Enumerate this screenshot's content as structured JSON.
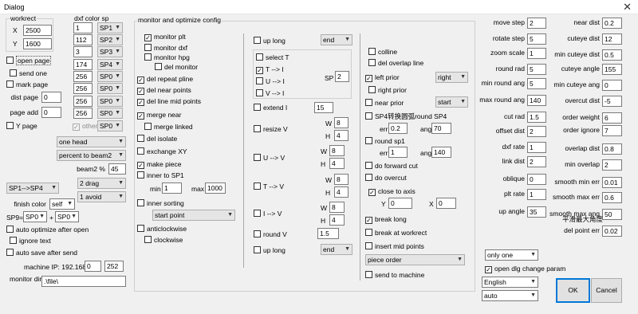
{
  "window": {
    "title": "Dialog",
    "close": "✕"
  },
  "workrect": {
    "label": "workrect",
    "x_label": "X",
    "x": "2500",
    "y_label": "Y",
    "y": "1600"
  },
  "left": {
    "open_page": "open page",
    "send_one": "send one",
    "mark_page": "mark page",
    "dist_page_label": "dist page",
    "dist_page": "0",
    "page_add_label": "page add",
    "page_add": "0",
    "y_page": "Y page"
  },
  "dxf_sp": {
    "label": "dxf color sp",
    "rows": [
      {
        "v": "1",
        "sp": "SP1"
      },
      {
        "v": "112",
        "sp": "SP2"
      },
      {
        "v": "3",
        "sp": "SP3"
      },
      {
        "v": "174",
        "sp": "SP4"
      },
      {
        "v": "256",
        "sp": "SP0"
      },
      {
        "v": "256",
        "sp": "SP0"
      },
      {
        "v": "256",
        "sp": "SP0"
      },
      {
        "v": "256",
        "sp": "SP0"
      }
    ],
    "other": "other",
    "other_sp": "SP0"
  },
  "head": {
    "one_head": "one head",
    "percent": "percent to beam2",
    "beam2_label": "beam2 %",
    "beam2": "45",
    "drag": "2 drag",
    "avoid": "1 avoid",
    "sp_route": "SP1-->SP4",
    "finish_color_label": "finish color",
    "finish_color": "self",
    "sp9_label": "SP9=",
    "sp9_a": "SP0",
    "plus": "+",
    "sp9_b": "SP0"
  },
  "bottom_left": {
    "auto_optimize": "auto optimize after open",
    "ignore_text": "ignore text",
    "auto_save": "auto save after send",
    "machine_ip_label": "machine IP: 192.168.",
    "ip3": "0",
    "ip4": "252",
    "monitor_dir_label": "monitor dir",
    "monitor_dir": ".\\file\\"
  },
  "monitor": {
    "title": "monitor and optimize config",
    "monitor_plt": "monitor plt",
    "monitor_dxf": "monitor dxf",
    "monitor_hpg": "monitor hpg",
    "del_monitor": "del monitor",
    "del_repeat": "del repeat pline",
    "del_near_points": "del near points",
    "del_line_mid": "del line mid points",
    "merge_near": "merge near",
    "merge_linked": "merge linked",
    "del_isolate": "del isolate",
    "exchange_xy": "exchange XY",
    "make_piece": "make piece",
    "inner_to_sp1": "inner to SP1",
    "min_label": "min",
    "min": "1",
    "max_label": "max",
    "max": "1000",
    "inner_sorting": "inner sorting",
    "start_point": "start point",
    "anticlockwise": "anticlockwise",
    "clockwise": "clockwise"
  },
  "col2": {
    "up_long": "up long",
    "up_long_sel": "end",
    "select_t": "select T",
    "t_i": "T --> I",
    "u_i": "U --> I",
    "v_i": "V --> I",
    "sp_label": "SP",
    "sp": "2",
    "extend_i": "extend I",
    "extend_i_val": "15",
    "resize_v": "resize V",
    "w": "W",
    "h": "H",
    "rv_w": "8",
    "rv_h": "4",
    "u_v": "U --> V",
    "uv_w": "8",
    "uv_h": "4",
    "t_v": "T --> V",
    "tv_w": "8",
    "tv_h": "4",
    "i_v": "I --> V",
    "iv_w": "8",
    "iv_h": "4",
    "round_v": "round V",
    "round_v_val": "1.5",
    "up_long2": "up long",
    "up_long2_sel": "end"
  },
  "col3": {
    "colline": "colline",
    "del_overlap": "del overlap line",
    "left_prior": "left prior",
    "left_prior_sel": "right",
    "right_prior": "right prior",
    "near_prior": "near prior",
    "near_prior_sel": "start",
    "sp4_round": "SP4转换圆弧round SP4",
    "err_label": "err",
    "err": "0.2",
    "ang_label": "ang",
    "ang": "70",
    "round_sp1": "round sp1",
    "err2": "1",
    "ang2": "140",
    "do_forward_cut": "do forward cut",
    "do_overcut": "do overcut",
    "close_to_axis": "close to axis",
    "y_label": "Y",
    "y": "0",
    "x_label": "X",
    "x": "0",
    "break_long": "break long",
    "break_at_workrect": "break at workrect",
    "insert_mid_points": "insert mid points",
    "piece_order": "piece order",
    "send_to_machine": "send to machine"
  },
  "right1": [
    {
      "l": "move step",
      "v": "2"
    },
    {
      "l": "rotate step",
      "v": "5"
    },
    {
      "l": "zoom scale",
      "v": "1"
    },
    {
      "l": "round rad",
      "v": "5"
    },
    {
      "l": "min round ang",
      "v": "5"
    },
    {
      "l": "max round ang",
      "v": "140"
    },
    {
      "l": "cut rad",
      "v": "1.5"
    },
    {
      "l": "offset dist",
      "v": "2"
    },
    {
      "l": "dxf rate",
      "v": "1"
    },
    {
      "l": "link dist",
      "v": "2"
    },
    {
      "l": "oblique",
      "v": "0"
    },
    {
      "l": "plt rate",
      "v": "1"
    },
    {
      "l": "up angle",
      "v": "35"
    }
  ],
  "right2": [
    {
      "l": "near dist",
      "v": "0.2"
    },
    {
      "l": "cuteye dist",
      "v": "12"
    },
    {
      "l": "min cuteye dist",
      "v": "0.5"
    },
    {
      "l": "cuteye angle",
      "v": "155"
    },
    {
      "l": "min cuteye ang",
      "v": "0"
    },
    {
      "l": "overcut dist",
      "v": "-5"
    },
    {
      "l": "order weight",
      "v": "6"
    },
    {
      "l": "order ignore",
      "v": "7"
    },
    {
      "l": "overlap dist",
      "v": "0.8"
    },
    {
      "l": "min overlap",
      "v": "2"
    },
    {
      "l": "smooth min err",
      "v": "0.01"
    },
    {
      "l": "smooth max err",
      "v": "0.6"
    },
    {
      "l": "smooth max ang",
      "v": "50"
    },
    {
      "l": "del point err",
      "v": "0.02"
    }
  ],
  "right_note": "平滑最大角度",
  "bottom_right": {
    "only_one": "only one",
    "open_dlg": "open dlg change param",
    "language": "English",
    "auto": "auto",
    "ok": "OK",
    "cancel": "Cancel"
  }
}
